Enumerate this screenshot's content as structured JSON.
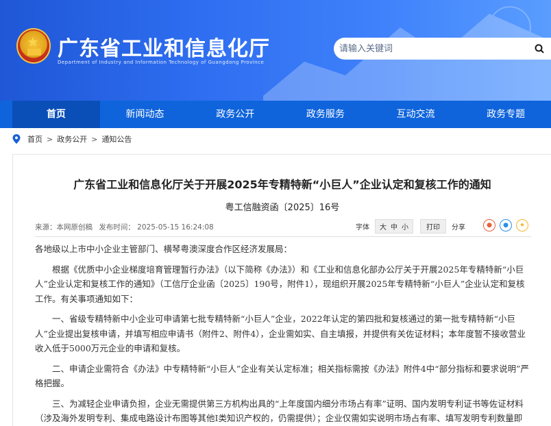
{
  "header": {
    "site_title": "广东省工业和信息化厅",
    "site_subtitle": "Department of Industry and Information Technology of Guangdong Province",
    "search_placeholder": "请输入关键词"
  },
  "nav": {
    "items": [
      {
        "label": "首页",
        "active": true
      },
      {
        "label": "新闻动态"
      },
      {
        "label": "政务公开"
      },
      {
        "label": "政务服务"
      },
      {
        "label": "互动交流"
      },
      {
        "label": "政务专题"
      }
    ]
  },
  "breadcrumb": {
    "items": [
      "首页",
      "政务公开",
      "通知公告"
    ],
    "separator": ">"
  },
  "article": {
    "title": "广东省工业和信息化厅关于开展2025年专精特新“小巨人”企业认定和复核工作的通知",
    "doc_number": "粤工信融资函〔2025〕16号",
    "source": "来源：本网原创稿",
    "publish_time": "发布时间：  2025-05-15 16:24:08",
    "font_label": "字体",
    "font_sizes": [
      "大",
      "中",
      "小"
    ],
    "print_label": "打印",
    "share_label": "分享",
    "paragraphs": [
      "各地级以上市中小企业主管部门、横琴粤澳深度合作区经济发展局：",
      "根据《优质中小企业梯度培育管理暂行办法》（以下简称《办法》）和《工业和信息化部办公厅关于开展2025年专精特新“小巨人”企业认定和复核工作的通知》（工信厅企业函〔2025〕190号，附件1），现组织开展2025年专精特新“小巨人”企业认定和复核工作。有关事项通知如下：",
      "一、省级专精特新中小企业可申请第七批专精特新“小巨人”企业，2022年认定的第四批和复核通过的第一批专精特新“小巨人”企业提出复核申请，并填写相应申请书（附件2、附件4），企业需如实、自主填报，并提供有关佐证材料；本年度暂不接收营业收入低于5000万元企业的申请和复核。",
      "二、申请企业需符合《办法》中专精特新“小巨人”企业有关认定标准；相关指标需按《办法》附件4中“部分指标和要求说明”严格把握。",
      "三、为减轻企业申请负担，企业无需提供第三方机构出具的“上年度国内细分市场占有率”证明、国内发明专利证书等佐证材料（涉及海外发明专利、集成电路设计布图等其他Ⅰ类知识产权的，仍需提供）；企业仅需如实说明市场占有率、填写发明专利数量即可。"
    ]
  },
  "colors": {
    "nav_bg": "#0f64dc",
    "nav_active": "#0a4fb8",
    "header_start": "#1f57d6",
    "header_end": "#5a9dff"
  }
}
